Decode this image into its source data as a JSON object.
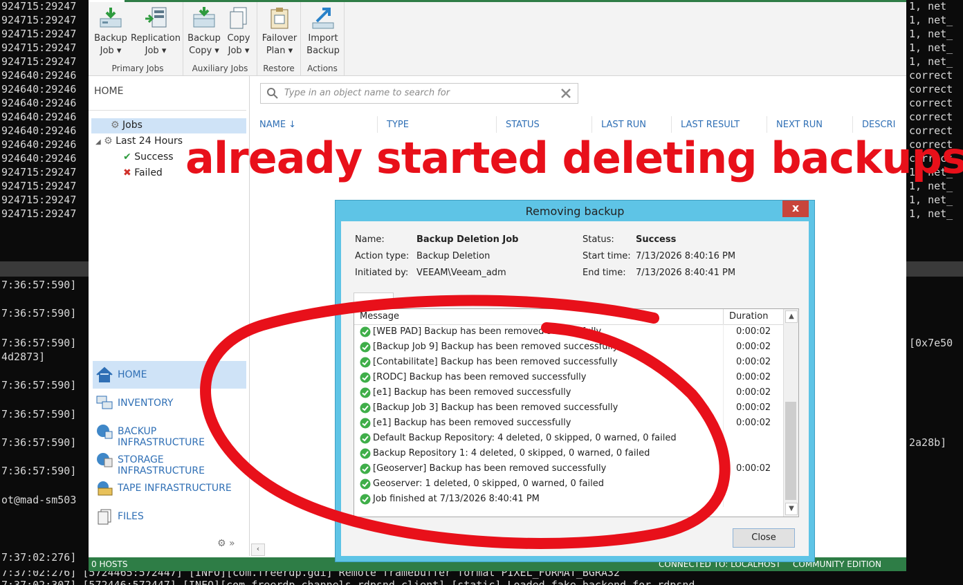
{
  "terminal": {
    "left_lines": [
      "924715:29247",
      "924715:29247",
      "924715:29247",
      "924715:29247",
      "924715:29247",
      "924640:29246",
      "924640:29246",
      "924640:29246",
      "924640:29246",
      "924640:29246",
      "924640:29246",
      "924640:29246",
      "924715:29247",
      "924715:29247",
      "924715:29247",
      "924715:29247"
    ],
    "left_lower": [
      "7:36:57:590]",
      "7:36:57:590]",
      "7:36:57:590]",
      "4d2873]",
      "7:36:57:590]",
      "7:36:57:590]",
      "7:36:57:590]",
      "7:36:57:590]",
      "ot@mad-sm503",
      "7:37:02:276]"
    ],
    "right_lines": [
      "1, net",
      "1, net_",
      "1, net_",
      "1, net_",
      "1, net_",
      "correct",
      "correct",
      "correct",
      "correct",
      "correct",
      "correct",
      "correct",
      "1, net_",
      "1, net_",
      "1, net_",
      "1, net_"
    ],
    "right_lower": [
      "[0x7e50",
      "2a28b]"
    ],
    "bottom_line": "7:37:02:276]  [5724465:572447]  [INFO][com.freerdp.gdi]   Remote framebuffer format PIXEL_FORMAT_BGRA32",
    "bottom_line2": "7:37:02:307]  [572446:572447]  [INFO][com.freerdp.channels.rdpsnd.client]   [static] Loaded fake backend for rdpsnd"
  },
  "ribbon": {
    "groups": [
      {
        "label": "Primary Jobs",
        "buttons": [
          {
            "line1": "Backup",
            "line2": "Job ▾",
            "icon": "backup-job-icon"
          },
          {
            "line1": "Replication",
            "line2": "Job ▾",
            "icon": "replication-job-icon"
          }
        ]
      },
      {
        "label": "Auxiliary Jobs",
        "buttons": [
          {
            "line1": "Backup",
            "line2": "Copy ▾",
            "icon": "backup-copy-icon"
          },
          {
            "line1": "Copy",
            "line2": "Job ▾",
            "icon": "copy-job-icon"
          }
        ]
      },
      {
        "label": "Restore",
        "buttons": [
          {
            "line1": "Failover",
            "line2": "Plan ▾",
            "icon": "failover-plan-icon"
          }
        ]
      },
      {
        "label": "Actions",
        "buttons": [
          {
            "line1": "Import",
            "line2": "Backup",
            "icon": "import-backup-icon"
          }
        ]
      }
    ]
  },
  "nav": {
    "home_header": "HOME",
    "tree": {
      "jobs": "Jobs",
      "last24": "Last 24 Hours",
      "success": "Success",
      "failed": "Failed"
    },
    "bottom": [
      {
        "label": "HOME",
        "icon": "home-icon"
      },
      {
        "label": "INVENTORY",
        "icon": "inventory-icon"
      },
      {
        "label": "BACKUP INFRASTRUCTURE",
        "icon": "backup-infrastructure-icon"
      },
      {
        "label": "STORAGE INFRASTRUCTURE",
        "icon": "storage-infrastructure-icon"
      },
      {
        "label": "TAPE INFRASTRUCTURE",
        "icon": "tape-infrastructure-icon"
      },
      {
        "label": "FILES",
        "icon": "files-icon"
      }
    ]
  },
  "content": {
    "search_placeholder": "Type in an object name to search for",
    "columns": [
      "NAME ↓",
      "TYPE",
      "STATUS",
      "LAST RUN",
      "LAST RESULT",
      "NEXT RUN",
      "DESCRI"
    ]
  },
  "overlay_text": "already started deleting backups",
  "statusbar": {
    "hosts": "0 HOSTS",
    "connected": "CONNECTED TO: LOCALHOST",
    "edition": "COMMUNITY EDITION"
  },
  "dialog": {
    "title": "Removing backup",
    "close_glyph": "x",
    "fields": {
      "name_label": "Name:",
      "name_value": "Backup Deletion Job",
      "action_label": "Action type:",
      "action_value": "Backup Deletion",
      "initiated_label": "Initiated by:",
      "initiated_value": "VEEAM\\Veeam_adm",
      "status_label": "Status:",
      "status_value": "Success",
      "start_label": "Start time:",
      "start_value": "7/13/2026 8:40:16 PM",
      "end_label": "End time:",
      "end_value": "7/13/2026 8:40:41 PM"
    },
    "grid_headers": {
      "message": "Message",
      "duration": "Duration"
    },
    "rows": [
      {
        "msg": "[WEB PAD] Backup has been removed successfully",
        "dur": "0:00:02"
      },
      {
        "msg": "[Backup Job 9] Backup has been removed successfully",
        "dur": "0:00:02"
      },
      {
        "msg": "[Contabilitate] Backup has been removed successfully",
        "dur": "0:00:02"
      },
      {
        "msg": "[RODC] Backup has been removed successfully",
        "dur": "0:00:02"
      },
      {
        "msg": "[e1] Backup has been removed successfully",
        "dur": "0:00:02"
      },
      {
        "msg": "[Backup Job 3] Backup has been removed successfully",
        "dur": "0:00:02"
      },
      {
        "msg": "[e1] Backup has been removed successfully",
        "dur": "0:00:02"
      },
      {
        "msg": "Default Backup Repository: 4 deleted, 0 skipped, 0 warned, 0 failed",
        "dur": ""
      },
      {
        "msg": "Backup Repository 1: 4 deleted, 0 skipped, 0 warned, 0 failed",
        "dur": ""
      },
      {
        "msg": "[Geoserver] Backup has been removed successfully",
        "dur": "0:00:02"
      },
      {
        "msg": "Geoserver: 1 deleted, 0 skipped, 0 warned, 0 failed",
        "dur": ""
      },
      {
        "msg": "Job finished at 7/13/2026 8:40:41 PM",
        "dur": ""
      }
    ],
    "close_label": "Close"
  },
  "colors": {
    "accent_green": "#2e7d46",
    "link_blue": "#2f6fb5",
    "dialog_frame": "#5ec4e6",
    "annotation_red": "#e8101a"
  }
}
